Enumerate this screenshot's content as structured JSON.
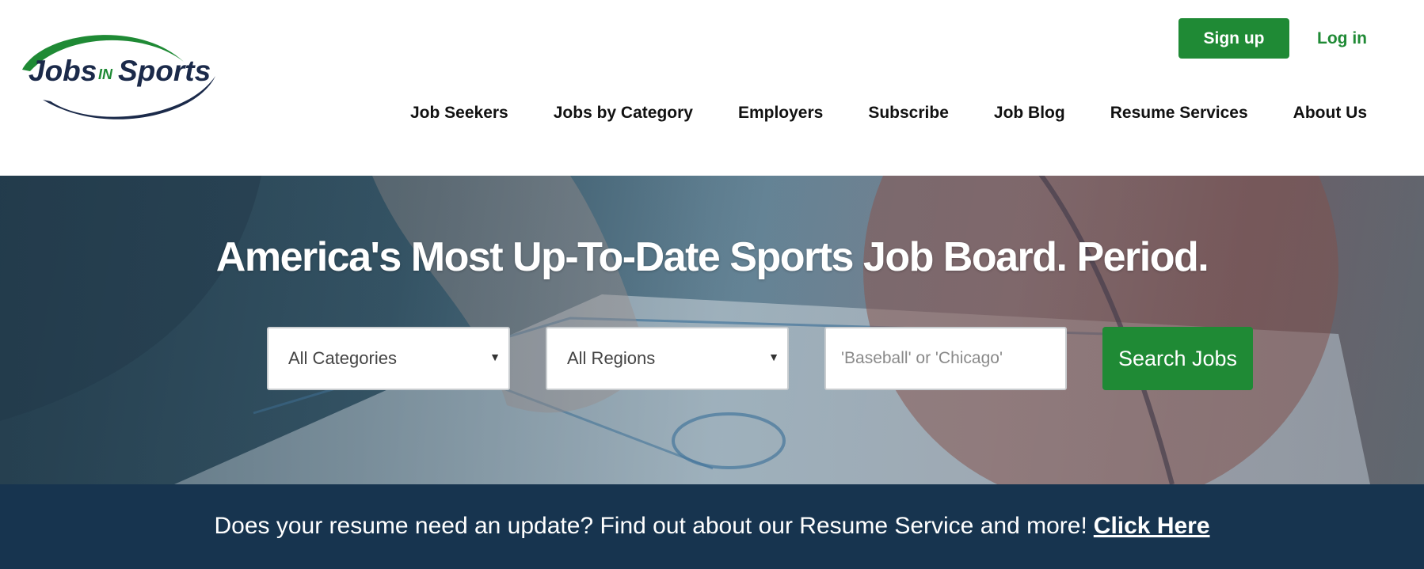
{
  "brand": {
    "logo_word1": "Jobs",
    "logo_word2": "IN",
    "logo_word3": "Sports",
    "green": "#1f8a35",
    "navy": "#1b2a4a"
  },
  "auth": {
    "signup_label": "Sign up",
    "login_label": "Log in"
  },
  "nav": {
    "items": [
      {
        "label": "Job Seekers"
      },
      {
        "label": "Jobs by Category"
      },
      {
        "label": "Employers"
      },
      {
        "label": "Subscribe"
      },
      {
        "label": "Job Blog"
      },
      {
        "label": "Resume Services"
      },
      {
        "label": "About Us"
      }
    ]
  },
  "hero": {
    "title": "America's Most Up-To-Date Sports Job Board. Period.",
    "category_select": {
      "selected": "All Categories",
      "icon": "caret-down-icon"
    },
    "region_select": {
      "selected": "All Regions",
      "icon": "caret-down-icon"
    },
    "keyword": {
      "value": "",
      "placeholder": "'Baseball' or 'Chicago'"
    },
    "search_label": "Search Jobs"
  },
  "banner": {
    "text": "Does your resume need an update? Find out about our Resume Service and more!",
    "link_label": "Click Here",
    "background": "#17344f"
  }
}
